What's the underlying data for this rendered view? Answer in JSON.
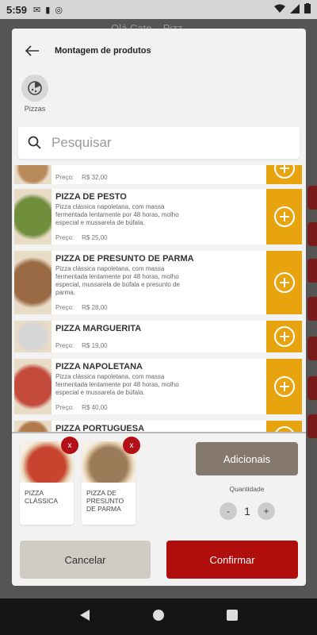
{
  "status": {
    "time": "5:59"
  },
  "background": {
    "title": "Olá Cate... Pizz..."
  },
  "modal": {
    "title": "Montagem de produtos",
    "category": {
      "label": "Pizzas",
      "icon": "pizza-icon"
    },
    "search": {
      "placeholder": "Pesquisar"
    },
    "price_label": "Preço:",
    "products": [
      {
        "name": "",
        "description": "",
        "price": "R$ 32,00",
        "thumb_color": "#b88a5a"
      },
      {
        "name": "PIZZA DE PESTO",
        "description": "Pizza clássica napoletana, com massa fermentada lentamente por 48 horas, molho especial e mussarela de búfala.",
        "price": "R$ 25,00",
        "thumb_color": "#6f8f3c"
      },
      {
        "name": "PIZZA DE PRESUNTO DE PARMA",
        "description": "Pizza clássica napoletana, com massa fermentada lentamente por 48 horas, molho especial, mussarela de búfala e presunto de parma.",
        "price": "R$ 28,00",
        "thumb_color": "#9a6a45"
      },
      {
        "name": "PIZZA MARGUERITA",
        "description": "",
        "price": "R$ 19,00",
        "thumb_color": "#d6d6d6"
      },
      {
        "name": "PIZZA NAPOLETANA",
        "description": "Pizza clássica napoletana, com massa fermentada lentamente por 48 horas, molho especial e mussarela de búfala.",
        "price": "R$ 40,00",
        "thumb_color": "#c44a3c"
      },
      {
        "name": "PIZZA PORTUGUESA",
        "description": "",
        "price": "",
        "thumb_color": "#b07a4a"
      }
    ],
    "selected": [
      {
        "label": "PIZZA CLÁSSICA",
        "remove": "x",
        "img_color": "#c8442e"
      },
      {
        "label": "PIZZA DE PRESUNTO DE PARMA",
        "remove": "x",
        "img_color": "#9c7b58"
      }
    ],
    "adicionais_label": "Adicionais",
    "quantity": {
      "label": "Quantidade",
      "minus": "-",
      "value": "1",
      "plus": "+"
    },
    "cancel_label": "Cancelar",
    "confirm_label": "Confirmar"
  },
  "colors": {
    "accent": "#e8a40f",
    "confirm": "#b10d0d",
    "adicionais": "#85786c",
    "remove": "#b30f16"
  }
}
